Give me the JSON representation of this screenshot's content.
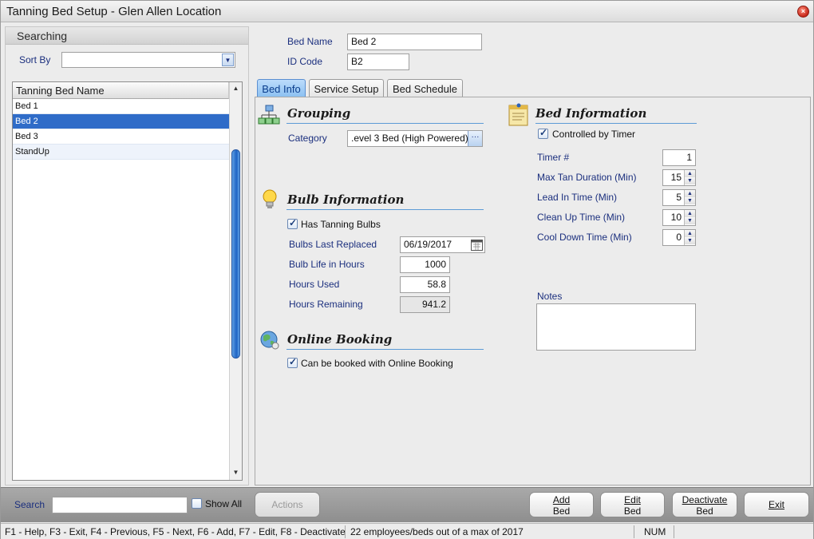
{
  "window": {
    "title": "Tanning Bed Setup - Glen Allen Location",
    "close_glyph": "×"
  },
  "search_panel": {
    "header": "Searching",
    "sort_by_label": "Sort By",
    "sort_by_value": "",
    "list_header": "Tanning Bed Name",
    "items": [
      {
        "label": "Bed 1",
        "selected": false
      },
      {
        "label": "Bed 2",
        "selected": true
      },
      {
        "label": "Bed 3",
        "selected": false
      },
      {
        "label": "StandUp",
        "selected": false
      }
    ]
  },
  "bed": {
    "name_label": "Bed Name",
    "name_value": "Bed 2",
    "id_label": "ID Code",
    "id_value": "B2"
  },
  "tabs": [
    {
      "label": "Bed Info",
      "active": true
    },
    {
      "label": "Service Setup",
      "active": false
    },
    {
      "label": "Bed Schedule",
      "active": false
    }
  ],
  "grouping": {
    "title": "Grouping",
    "icon": "hierarchy-icon",
    "category_label": "Category",
    "category_value": ".evel 3 Bed (High Powered)",
    "browse_label": "···"
  },
  "bulb": {
    "title": "Bulb Information",
    "icon": "lightbulb-icon",
    "has_bulbs_label": "Has Tanning Bulbs",
    "has_bulbs_checked": true,
    "last_replaced_label": "Bulbs Last Replaced",
    "last_replaced_value": "06/19/2017",
    "life_label": "Bulb Life in Hours",
    "life_value": "1000",
    "used_label": "Hours Used",
    "used_value": "58.8",
    "remaining_label": "Hours Remaining",
    "remaining_value": "941.2"
  },
  "online": {
    "title": "Online Booking",
    "icon": "globe-icon",
    "booking_label": "Can be booked with Online Booking",
    "booking_checked": true
  },
  "bed_info": {
    "title": "Bed Information",
    "icon": "notepad-icon",
    "timer_controlled_label": "Controlled by Timer",
    "timer_controlled_checked": true,
    "timer_label": "Timer #",
    "timer_value": "1",
    "max_tan_label": "Max Tan Duration (Min)",
    "max_tan_value": "15",
    "lead_in_label": "Lead In Time (Min)",
    "lead_in_value": "5",
    "clean_up_label": "Clean Up Time (Min)",
    "clean_up_value": "10",
    "cool_down_label": "Cool Down Time (Min)",
    "cool_down_value": "0",
    "notes_label": "Notes",
    "notes_value": ""
  },
  "bottom": {
    "search_label": "Search",
    "search_value": "",
    "show_all_label": "Show All",
    "show_all_checked": false,
    "actions_label": "Actions",
    "add_line1": "Add",
    "add_line2": "Bed",
    "edit_line1": "Edit",
    "edit_line2": "Bed",
    "deactivate_line1": "Deactivate",
    "deactivate_line2": "Bed",
    "exit_label": "Exit"
  },
  "status": {
    "keys": "F1 - Help, F3 - Exit, F4 - Previous, F5 - Next, F6 - Add, F7 - Edit, F8 - Deactivate",
    "count": "22 employees/beds out of a max of 2017",
    "num": "NUM"
  }
}
